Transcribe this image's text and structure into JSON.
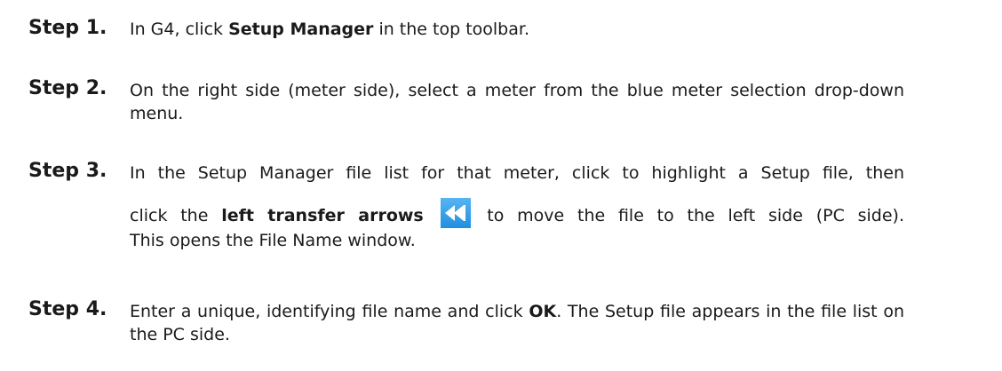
{
  "steps": [
    {
      "label": "Step 1.",
      "pre": "In G4, click ",
      "bold": "Setup Manager",
      "post": " in the top toolbar."
    },
    {
      "label": "Step 2.",
      "text": "On the right side (meter side), select a meter from the blue meter selection drop-down menu."
    },
    {
      "label": "Step 3.",
      "line1": "In the Setup Manager file list for that meter, click to highlight a Setup file, then",
      "line2_pre": "click the ",
      "line2_bold": "left transfer arrows",
      "icon": "rewind-arrows-icon",
      "line2_post": " to move the file to the left side (PC side).",
      "rest": "This opens the File Name window."
    },
    {
      "label": "Step 4.",
      "pre": "Enter a unique, identifying file name and click ",
      "bold": "OK",
      "post": ". The Setup file appears in the file list on the PC side."
    }
  ],
  "colors": {
    "icon_blue": "#1f8fdf",
    "icon_blue_light": "#57b5f2"
  }
}
